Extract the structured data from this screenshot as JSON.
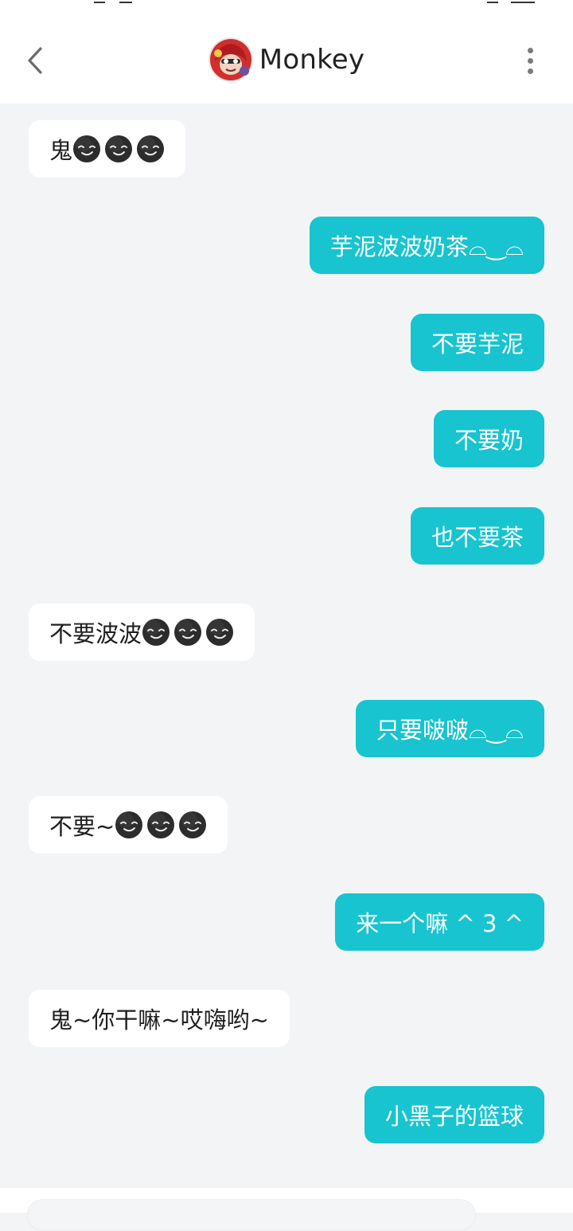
{
  "header": {
    "title": "Monkey",
    "icons": [
      "back-icon",
      "avatar",
      "more-vertical-icon"
    ]
  },
  "emoji": {
    "name": "smirk-face-emoji",
    "color": "#2c2c2c"
  },
  "messages": [
    {
      "side": "in",
      "text": "鬼",
      "emoji_count": 3
    },
    {
      "side": "out",
      "text": "芋泥波波奶茶⌓‿⌓",
      "emoji_count": 0
    },
    {
      "side": "out",
      "text": "不要芋泥",
      "emoji_count": 0
    },
    {
      "side": "out",
      "text": "不要奶",
      "emoji_count": 0
    },
    {
      "side": "out",
      "text": "也不要茶",
      "emoji_count": 0
    },
    {
      "side": "in",
      "text": "不要波波",
      "emoji_count": 3
    },
    {
      "side": "out",
      "text": "只要啵啵⌓‿⌓",
      "emoji_count": 0
    },
    {
      "side": "in",
      "text": "不要~",
      "emoji_count": 3
    },
    {
      "side": "out",
      "text": "来一个嘛 ^ 3 ^",
      "emoji_count": 0
    },
    {
      "side": "in",
      "text": "鬼~你干嘛~哎嗨哟~",
      "emoji_count": 0
    },
    {
      "side": "out",
      "text": "小黑子的篮球",
      "emoji_count": 0
    }
  ],
  "colors": {
    "outgoing_bubble": "#17c4cf",
    "incoming_bubble": "#ffffff",
    "background": "#f3f4f6"
  }
}
